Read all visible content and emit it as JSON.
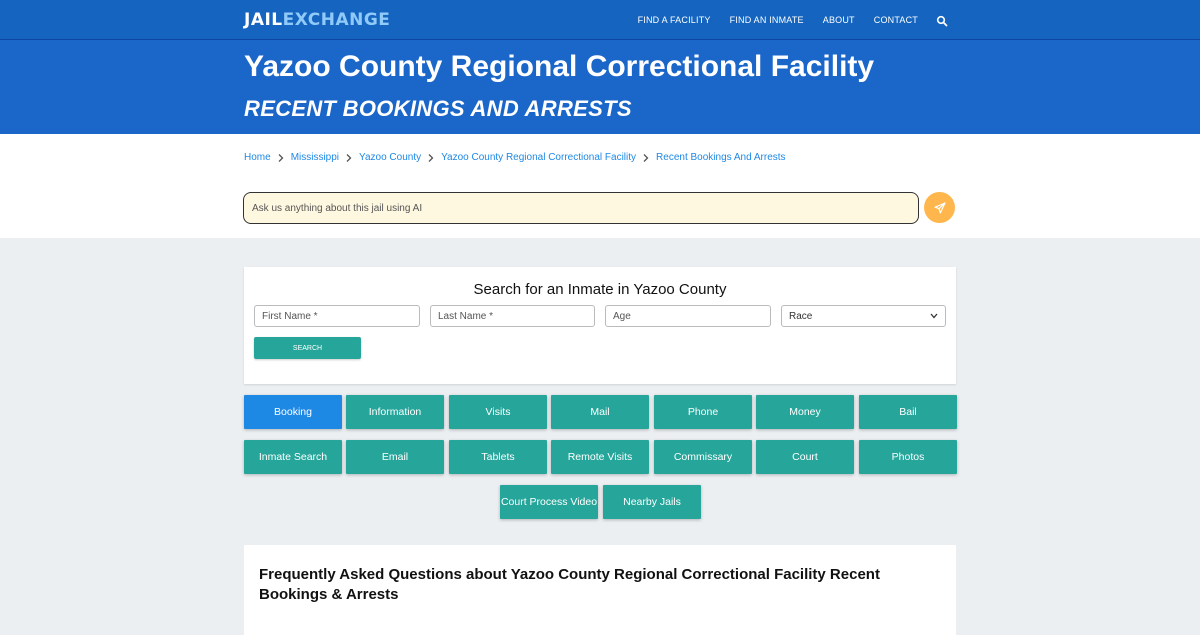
{
  "header": {
    "logo_part1": "JAIL",
    "logo_part2": "EXCHANGE",
    "nav": [
      "FIND A FACILITY",
      "FIND AN INMATE",
      "ABOUT",
      "CONTACT"
    ],
    "search_icon": "search-icon"
  },
  "hero": {
    "title": "Yazoo County Regional Correctional Facility",
    "subtitle": "RECENT BOOKINGS AND ARRESTS"
  },
  "breadcrumb": [
    "Home",
    "Mississippi",
    "Yazoo County",
    "Yazoo County Regional Correctional Facility",
    "Recent Bookings And Arrests"
  ],
  "ai": {
    "placeholder": "Ask us anything about this jail using AI",
    "send_icon": "send-icon"
  },
  "search_card": {
    "title": "Search for an Inmate in Yazoo County",
    "first_name_placeholder": "First Name *",
    "last_name_placeholder": "Last Name *",
    "age_placeholder": "Age",
    "race_selected": "Race",
    "button": "SEARCH"
  },
  "tiles": {
    "row1": [
      "Booking",
      "Information",
      "Visits",
      "Mail",
      "Phone",
      "Money",
      "Bail"
    ],
    "row2": [
      "Inmate Search",
      "Email",
      "Tablets",
      "Remote Visits",
      "Commissary",
      "Court",
      "Photos"
    ],
    "row3": [
      "Court Process Video",
      "Nearby Jails"
    ],
    "active": "Booking"
  },
  "faq": {
    "title": "Frequently Asked Questions about Yazoo County Regional Correctional Facility Recent Bookings & Arrests"
  },
  "colors": {
    "header_blue": "#1565c0",
    "hero_blue": "#1a66c9",
    "teal": "#26a69a",
    "active_blue": "#1e88e5",
    "link_blue": "#1e88e5",
    "ai_input_bg": "#fff8e1",
    "send_orange": "#ffb74d",
    "page_bg": "#eceff1"
  }
}
